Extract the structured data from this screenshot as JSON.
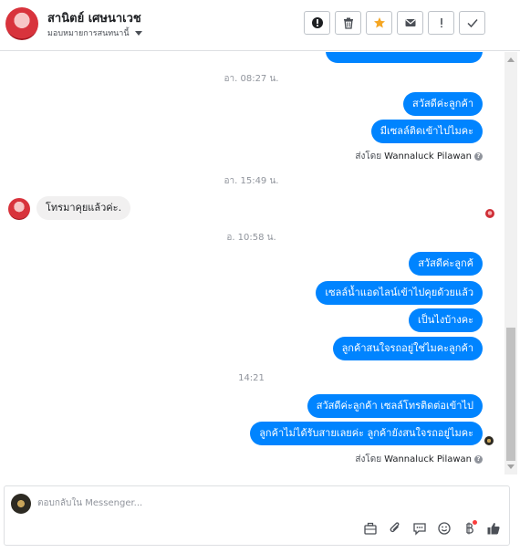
{
  "header": {
    "contact_name": "สานิตย์ เศษนาเวช",
    "assign_label": "มอบหมายการสนทนานี้",
    "actions": [
      {
        "name": "mark-spam-button",
        "icon": "exclamation-circle-icon"
      },
      {
        "name": "delete-button",
        "icon": "trash-icon"
      },
      {
        "name": "star-button",
        "icon": "star-icon"
      },
      {
        "name": "mark-unread-button",
        "icon": "envelope-icon"
      },
      {
        "name": "follow-up-button",
        "icon": "exclamation-icon"
      },
      {
        "name": "mark-done-button",
        "icon": "checkmark-icon"
      }
    ],
    "colors": {
      "star": "#f5a623",
      "icon": "#4b4f56"
    }
  },
  "conversation": {
    "timestamp_1": "อา. 08:27 น.",
    "out_1": "สวัสดีค่ะลูกค้า",
    "out_2": "มีเซลล์ติดเข้าไปไมคะ",
    "sent_by_1": {
      "prefix": "ส่งโดย",
      "agent": "Wannaluck Pilawan"
    },
    "timestamp_2": "อา. 15:49 น.",
    "in_1": "โทรมาคุยแล้วค่ะ.",
    "timestamp_3": "อ. 10:58 น.",
    "out_3": "สวัสดีค่ะลูกค้",
    "out_4": "เซลล์น้ำแอดไลน์เข้าไปคุยด้วยแล้ว",
    "out_5": "เป็นไงบ้างคะ",
    "out_6": "ลูกค้าสนใจรถอยู่ใช่ไมคะลูกค้า",
    "timestamp_4": "14:21",
    "out_7": "สวัสดีค่ะลูกค้า เซลล์โทรติดต่อเข้าไป",
    "out_8": "ลูกค้าไม่ได้รับสายเลยค่ะ ลูกค้ายังสนใจรถอยู่ไมคะ",
    "sent_by_2": {
      "prefix": "ส่งโดย",
      "agent": "Wannaluck Pilawan"
    },
    "colors": {
      "outgoing": "#0084ff",
      "incoming": "#f1f0f0"
    }
  },
  "composer": {
    "placeholder": "ตอบกลับใน Messenger...",
    "tools": [
      "briefcase-icon",
      "paperclip-icon",
      "saved-reply-icon",
      "emoji-icon",
      "payment-icon",
      "thumbs-up-icon"
    ]
  }
}
